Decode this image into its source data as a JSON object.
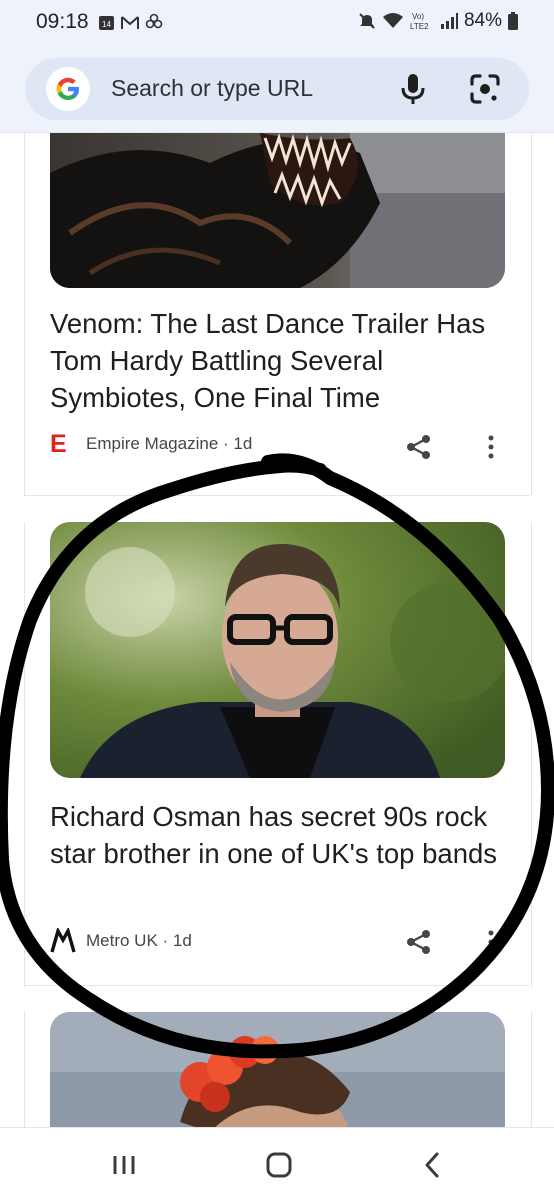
{
  "status_bar": {
    "time": "09:18",
    "left_icons": [
      "calendar-icon",
      "gmail-icon",
      "pinwheel-icon"
    ],
    "right_icons": [
      "mute-icon",
      "wifi-icon",
      "volte-icon",
      "signal-icon",
      "battery-icon"
    ],
    "volte_label": "Vo)\nLTE2",
    "battery": "84%"
  },
  "search_bar": {
    "placeholder": "Search or type URL",
    "left_icon": "google-logo-icon",
    "right_icons": [
      "microphone-icon",
      "google-lens-icon"
    ],
    "colors": {
      "bar_bg": "#eef2fb",
      "box_bg": "#dfe7f5"
    }
  },
  "feed": {
    "cards": [
      {
        "image_alt": "Venom creature with sharp teeth",
        "title": "Venom: The Last Dance Trailer Has Tom Hardy Battling Several Symbiotes, One Final Time",
        "publisher_logo": "E",
        "publisher": "Empire Magazine",
        "separator": " · ",
        "age": "1d",
        "actions": [
          "share-icon",
          "more-vert-icon"
        ]
      },
      {
        "image_alt": "Man with glasses and grey beard in dark jacket",
        "title": "Richard Osman has secret 90s rock star brother in one of UK's top bands",
        "publisher_logo": "M",
        "publisher": "Metro UK",
        "separator": " · ",
        "age": "1d",
        "actions": [
          "share-icon",
          "more-vert-icon"
        ]
      },
      {
        "image_alt": "Person with red flower headpiece"
      }
    ]
  },
  "nav_bar": {
    "buttons": [
      "recent-apps-icon",
      "home-icon",
      "back-icon"
    ]
  },
  "overlay": {
    "annotation": "hand-drawn black circle around second card",
    "color": "#000000"
  }
}
